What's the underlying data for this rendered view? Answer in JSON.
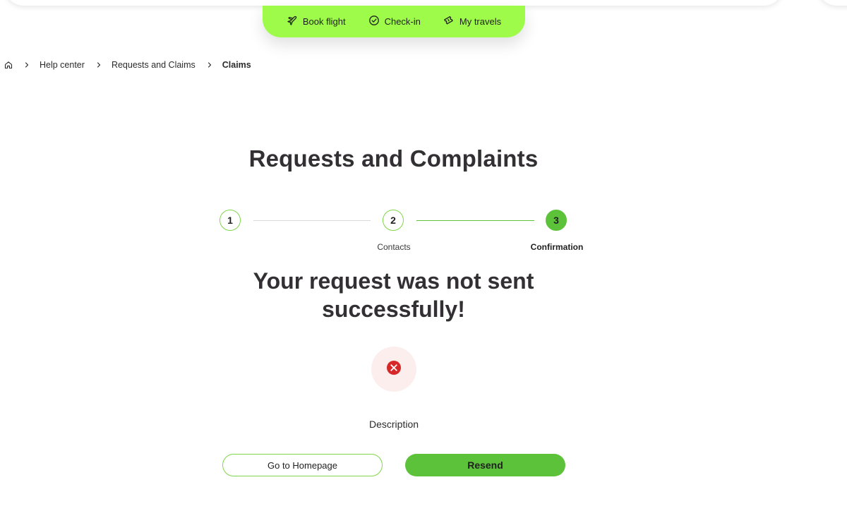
{
  "quicknav": {
    "items": [
      {
        "label": "Book flight",
        "icon": "plane-icon"
      },
      {
        "label": "Check-in",
        "icon": "check-circle-icon"
      },
      {
        "label": "My travels",
        "icon": "ticket-icon"
      }
    ]
  },
  "breadcrumb": {
    "home_icon": "home-icon",
    "items": [
      "Help center",
      "Requests and Claims"
    ],
    "current": "Claims"
  },
  "page": {
    "title": "Requests and Complaints"
  },
  "stepper": {
    "steps": [
      {
        "number": "1",
        "label": "",
        "state": "done"
      },
      {
        "number": "2",
        "label": "Contacts",
        "state": "done"
      },
      {
        "number": "3",
        "label": "Confirmation",
        "state": "active"
      }
    ]
  },
  "result": {
    "title": "Your request was not sent successfully!",
    "status_icon": "error-x-icon",
    "description": "Description"
  },
  "actions": {
    "home_label": "Go to Homepage",
    "resend_label": "Resend"
  },
  "colors": {
    "brand_green": "#9efb4a",
    "accent_green": "#5cc23a",
    "error_red": "#d62828",
    "error_bg": "#fdeeee"
  }
}
